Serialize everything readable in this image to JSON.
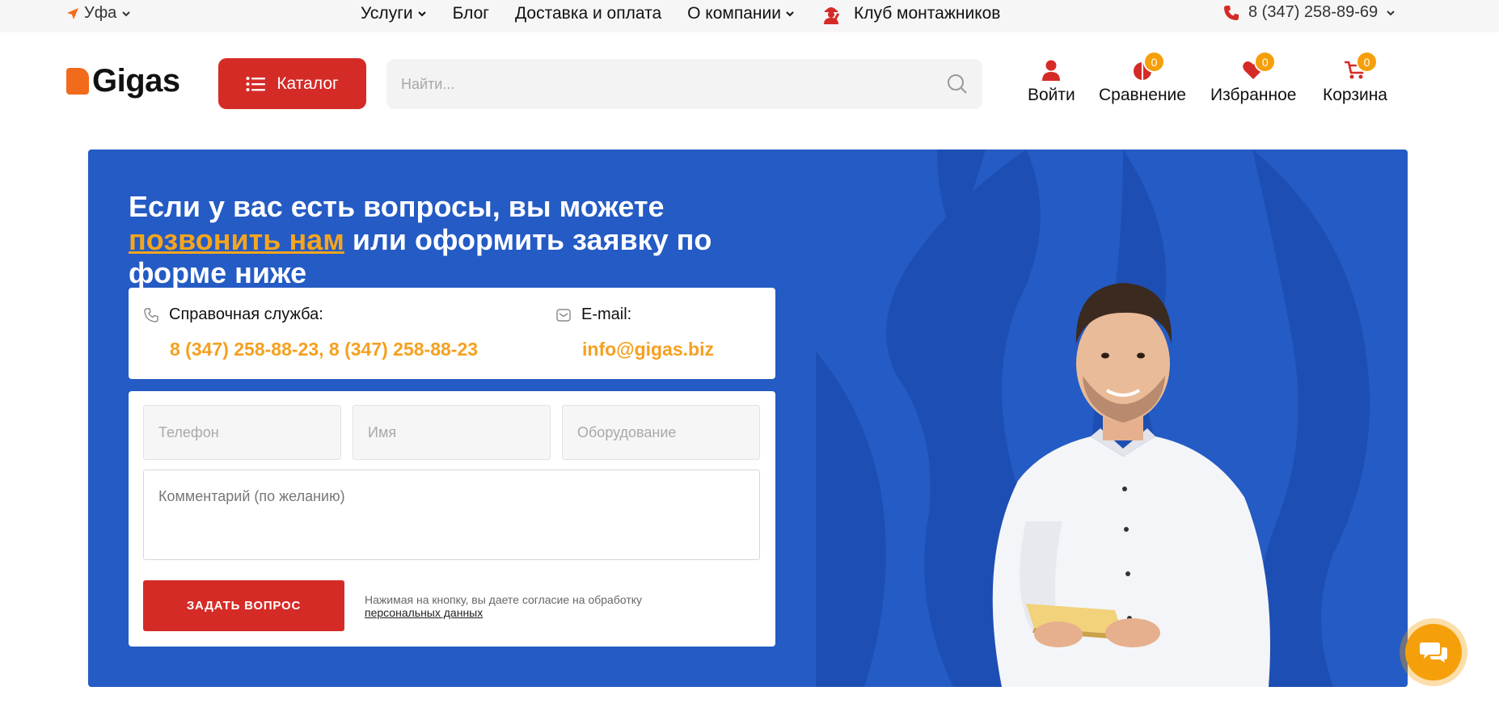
{
  "topbar": {
    "city": "Уфа",
    "nav": [
      {
        "label": "Услуги",
        "dropdown": true
      },
      {
        "label": "Блог",
        "dropdown": false
      },
      {
        "label": "Доставка и оплата",
        "dropdown": false
      },
      {
        "label": "О компании",
        "dropdown": true
      }
    ],
    "club_label": "Клуб монтажников",
    "phone": "8 (347) 258-89-69"
  },
  "header": {
    "logo_text": "Gigas",
    "catalog_label": "Каталог",
    "search_placeholder": "Найти...",
    "icons": [
      {
        "name": "login",
        "label": "Войти"
      },
      {
        "name": "compare",
        "label": "Сравнение",
        "count": "0"
      },
      {
        "name": "favorites",
        "label": "Избранное",
        "count": "0"
      },
      {
        "name": "cart",
        "label": "Корзина",
        "count": "0"
      }
    ]
  },
  "banner": {
    "headline_part1": "Если у вас есть вопросы, вы можете ",
    "headline_link": "позвонить нам",
    "headline_part2": " или оформить заявку по форме ниже",
    "help_label": "Справочная служба:",
    "help_phones": "8 (347) 258-88-23, 8 (347) 258-88-23",
    "email_label": "E-mail:",
    "email_value": "info@gigas.biz"
  },
  "form": {
    "phone_placeholder": "Телефон",
    "name_placeholder": "Имя",
    "equipment_placeholder": "Оборудование",
    "comment_placeholder": "Комментарий (по желанию)",
    "submit_label": "ЗАДАТЬ ВОПРОС",
    "consent_text": "Нажимая на кнопку, вы даете согласие на обработку",
    "consent_link": "персональных данных"
  },
  "colors": {
    "brand_red": "#d52b27",
    "accent_orange": "#f5a020",
    "banner_blue": "#245bc4"
  }
}
